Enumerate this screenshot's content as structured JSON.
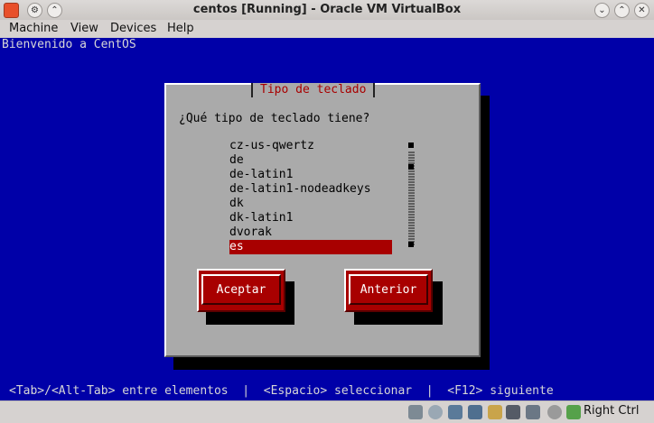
{
  "window": {
    "title": "centos [Running] - Oracle VM VirtualBox"
  },
  "menu": [
    "Machine",
    "View",
    "Devices",
    "Help"
  ],
  "console": {
    "welcome": "Bienvenido a CentOS",
    "dialog_title": "Tipo de teclado",
    "question": "¿Qué tipo de teclado tiene?",
    "items": [
      "cz-us-qwertz",
      "de",
      "de-latin1",
      "de-latin1-nodeadkeys",
      "dk",
      "dk-latin1",
      "dvorak",
      "es"
    ],
    "selected_index": 7,
    "buttons": {
      "accept": "Aceptar",
      "back": "Anterior"
    },
    "help": "<Tab>/<Alt-Tab> entre elementos  |  <Espacio> seleccionar  |  <F12> siguiente"
  },
  "statusbar": {
    "host_key": "Right Ctrl",
    "icons": [
      "hard-disk-icon",
      "optical-drive-icon",
      "usb-icon",
      "network-icon",
      "shared-folders-icon",
      "display-icon",
      "capture-icon",
      "mouse-integration-icon",
      "host-key-icon"
    ]
  },
  "colors": {
    "console_bg": "#0000a8",
    "dialog_bg": "#aaaaaa",
    "accent": "#a80000"
  }
}
